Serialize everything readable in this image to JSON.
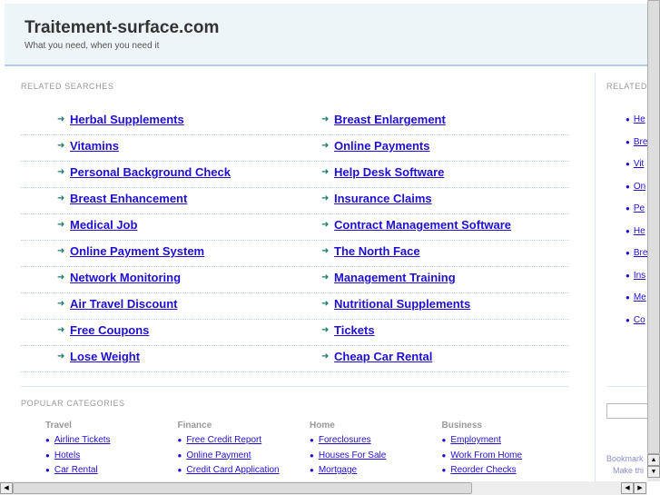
{
  "header": {
    "title": "Traitement-surface.com",
    "tagline": "What you need, when you need it"
  },
  "related": {
    "heading": "RELATED SEARCHES",
    "left": [
      "Herbal Supplements",
      "Vitamins",
      "Personal Background Check",
      "Breast Enhancement",
      "Medical Job",
      "Online Payment System",
      "Network Monitoring",
      "Air Travel Discount",
      "Free Coupons",
      "Lose Weight"
    ],
    "right": [
      "Breast Enlargement",
      "Online Payments",
      "Help Desk Software",
      "Insurance Claims",
      "Contract Management Software",
      "The North Face",
      "Management Training",
      "Nutritional Supplements",
      "Tickets",
      "Cheap Car Rental"
    ]
  },
  "sidebar": {
    "heading": "RELATED",
    "items": [
      "He",
      "Bre",
      "Vit",
      "On",
      "Pe",
      "He",
      "Bre",
      "Ins",
      "Me",
      "Co"
    ],
    "bookmark": "Bookmark",
    "make": "Make thi"
  },
  "popular": {
    "heading": "POPULAR CATEGORIES",
    "categories": [
      {
        "title": "Travel",
        "links": [
          "Airline Tickets",
          "Hotels",
          "Car Rental"
        ]
      },
      {
        "title": "Finance",
        "links": [
          "Free Credit Report",
          "Online Payment",
          "Credit Card Application"
        ]
      },
      {
        "title": "Home",
        "links": [
          "Foreclosures",
          "Houses For Sale",
          "Mortgage"
        ]
      },
      {
        "title": "Business",
        "links": [
          "Employment",
          "Work From Home",
          "Reorder Checks"
        ]
      }
    ]
  },
  "icons": {
    "bullet": "arrow-right-icon",
    "accent": "#1f10d0",
    "arrow_color": "#1a7a6a"
  }
}
